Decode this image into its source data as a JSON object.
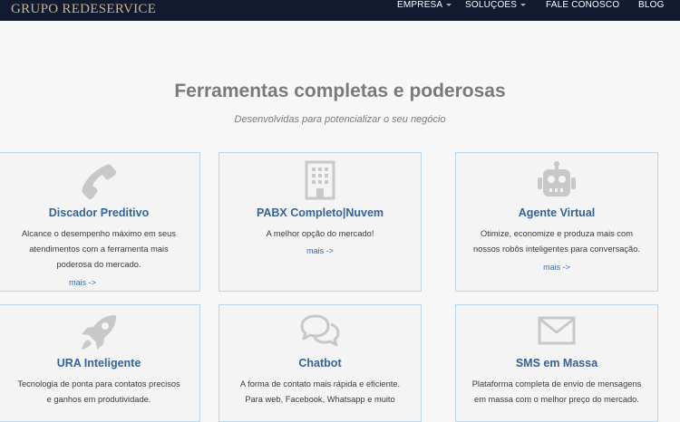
{
  "navbar": {
    "logo": "GRUPO REDESERVICE",
    "items": [
      {
        "label": "EMPRESA",
        "dropdown": true
      },
      {
        "label": "SOLUÇÕES",
        "dropdown": true
      },
      {
        "label": "FALE CONOSCO",
        "dropdown": false
      },
      {
        "label": "BLOG",
        "dropdown": false
      }
    ]
  },
  "main": {
    "title": "Ferramentas completas e poderosas",
    "subtitle": "Desenvolvidas para potencializar o seu negócio",
    "cards": [
      {
        "icon": "phone-icon",
        "title": "Discador Preditivo",
        "lines": [
          "Alcance o desempenho máximo em seus",
          "atendimentos com a ferramenta mais",
          "poderosa do mercado."
        ],
        "link": "mais ->"
      },
      {
        "icon": "building-icon",
        "title": "PABX Completo|Nuvem",
        "lines": [
          "A melhor opção do mercado!"
        ],
        "link": "mais ->"
      },
      {
        "icon": "robot-icon",
        "title": "Agente Virtual",
        "lines": [
          "Otimize, economize e produza mais com",
          "nossos robôs inteligentes para conversação."
        ],
        "link": "mais ->"
      },
      {
        "icon": "rocket-icon",
        "title": "URA Inteligente",
        "lines": [
          "Tecnologia de ponta para contatos precisos",
          "e ganhos em produtividade."
        ],
        "link": ""
      },
      {
        "icon": "chat-bubbles-icon",
        "title": "Chatbot",
        "lines": [
          "A forma de contato mais rápida e eficiente.",
          "Para web, Facebook, Whatsapp e muito"
        ],
        "link": ""
      },
      {
        "icon": "envelope-icon",
        "title": "SMS em Massa",
        "lines": [
          "Plataforma completa de envio de mensagens",
          "em massa com o melhor preço do mercado."
        ],
        "link": ""
      }
    ]
  },
  "colors": {
    "navbar": "#111a2e",
    "logo": "#c7b58c",
    "title": "#376294",
    "link": "#2f6fb6",
    "icon": "#c8c8c8",
    "border": "#b9d6ee"
  }
}
